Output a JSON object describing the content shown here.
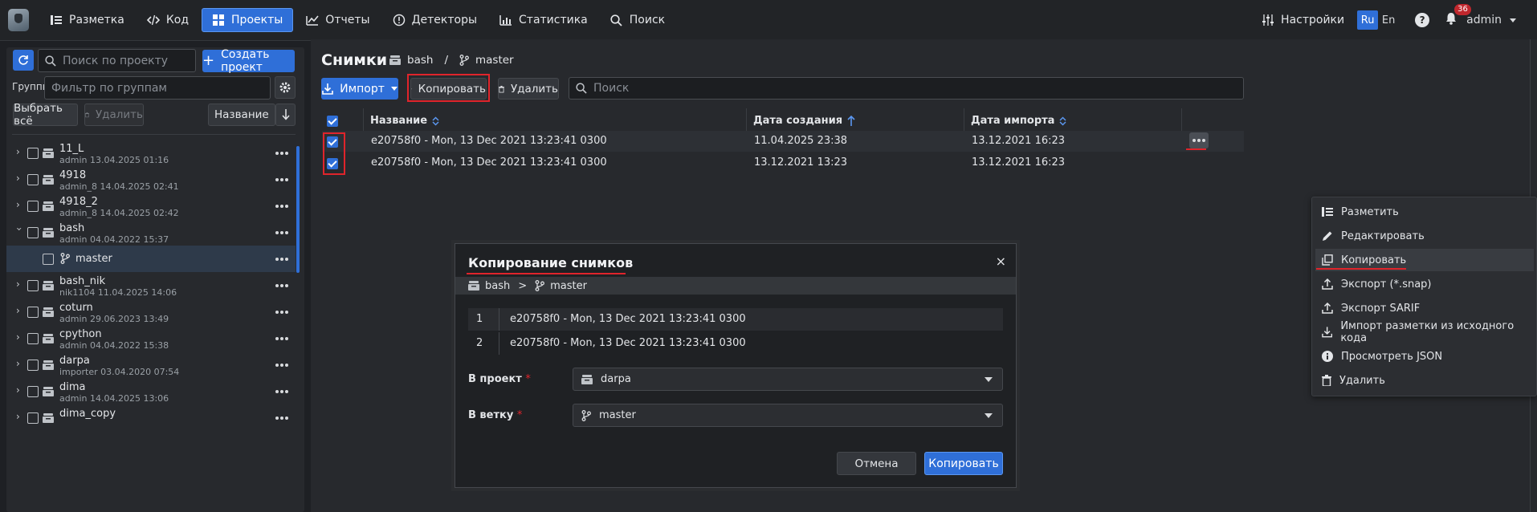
{
  "nav": {
    "items": [
      {
        "label": "Разметка",
        "icon": "list-icon"
      },
      {
        "label": "Код",
        "icon": "code-icon"
      },
      {
        "label": "Проекты",
        "icon": "projects-icon"
      },
      {
        "label": "Отчеты",
        "icon": "chart-icon"
      },
      {
        "label": "Детекторы",
        "icon": "alert-icon"
      },
      {
        "label": "Статистика",
        "icon": "stats-icon"
      },
      {
        "label": "Поиск",
        "icon": "search-icon"
      }
    ],
    "settings": "Настройки",
    "lang_ru": "Ru",
    "lang_en": "En",
    "notifications": "36",
    "user": "admin"
  },
  "sidebar": {
    "search_placeholder": "Поиск по проекту",
    "create_project": "Создать проект",
    "groups_label": "Группы",
    "groups_placeholder": "Фильтр по группам",
    "select_all": "Выбрать всё",
    "delete": "Удалить",
    "sort_by": "Название",
    "projects": [
      {
        "name": "11_L",
        "meta": "admin 13.04.2025 01:16"
      },
      {
        "name": "4918",
        "meta": "admin_8 14.04.2025 02:41"
      },
      {
        "name": "4918_2",
        "meta": "admin_8 14.04.2025 02:42"
      },
      {
        "name": "bash",
        "meta": "admin 04.04.2022 15:37"
      },
      {
        "name": "master",
        "meta": ""
      },
      {
        "name": "bash_nik",
        "meta": "nik1104 11.04.2025 14:06"
      },
      {
        "name": "coturn",
        "meta": "admin 29.06.2023 13:49"
      },
      {
        "name": "cpython",
        "meta": "admin 04.04.2022 15:38"
      },
      {
        "name": "darpa",
        "meta": "importer 03.04.2020 07:54"
      },
      {
        "name": "dima",
        "meta": "admin 14.04.2025 13:06"
      },
      {
        "name": "dima_copy",
        "meta": ""
      }
    ]
  },
  "main": {
    "title": "Снимки",
    "project": "bash",
    "separator": "/",
    "branch": "master",
    "import_btn": "Импорт",
    "copy_btn": "Копировать",
    "delete_btn": "Удалить",
    "search_placeholder": "Поиск",
    "table": {
      "columns": [
        "Название",
        "Дата создания",
        "Дата импорта"
      ],
      "rows": [
        {
          "name": "e20758f0 - Mon, 13 Dec 2021 13:23:41 0300",
          "created": "11.04.2025 23:38",
          "imported": "13.12.2021 16:23"
        },
        {
          "name": "e20758f0 - Mon, 13 Dec 2021 13:23:41 0300",
          "created": "13.12.2021 13:23",
          "imported": "13.12.2021 16:23"
        }
      ]
    }
  },
  "context_menu": {
    "items": [
      {
        "label": "Разметить",
        "icon": "markup-icon"
      },
      {
        "label": "Редактировать",
        "icon": "pencil-icon"
      },
      {
        "label": "Копировать",
        "icon": "copy-icon"
      },
      {
        "label": "Экспорт (*.snap)",
        "icon": "export-icon"
      },
      {
        "label": "Экспорт SARIF",
        "icon": "export-icon"
      },
      {
        "label": "Импорт разметки из исходного кода",
        "icon": "import-icon"
      },
      {
        "label": "Просмотреть JSON",
        "icon": "info-icon"
      },
      {
        "label": "Удалить",
        "icon": "trash-icon"
      }
    ]
  },
  "modal": {
    "title": "Копирование снимков",
    "close": "×",
    "crumb_project": "bash",
    "crumb_sep": ">",
    "crumb_branch": "master",
    "rows": [
      {
        "n": "1",
        "name": "e20758f0 - Mon, 13 Dec 2021 13:23:41 0300"
      },
      {
        "n": "2",
        "name": "e20758f0 - Mon, 13 Dec 2021 13:23:41 0300"
      }
    ],
    "to_project_label": "В проект",
    "to_project_value": "darpa",
    "to_branch_label": "В ветку",
    "to_branch_value": "master",
    "required_mark": "*",
    "cancel": "Отмена",
    "copy": "Копировать"
  }
}
